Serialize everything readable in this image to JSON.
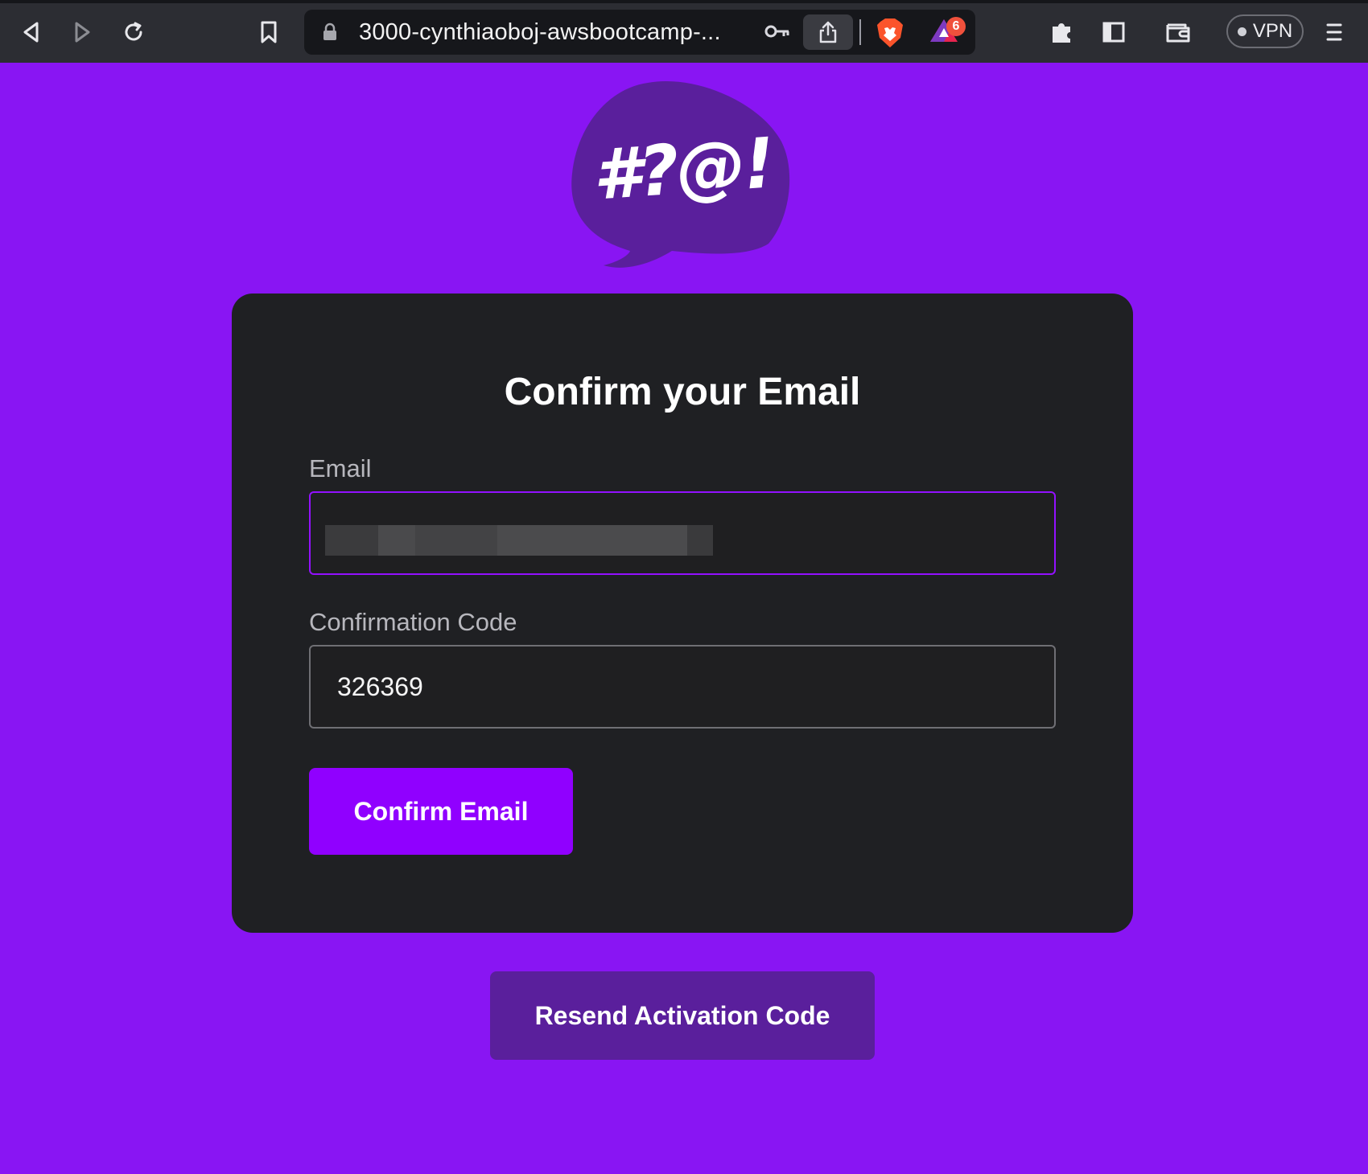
{
  "browser": {
    "url": "3000-cynthiaoboj-awsbootcamp-...",
    "rewards_badge": "6",
    "vpn_label": "VPN",
    "icons": [
      "back-icon",
      "forward-icon",
      "reload-icon",
      "bookmark-icon",
      "lock-icon",
      "key-icon",
      "share-icon",
      "brave-shields-icon",
      "brave-rewards-icon",
      "extensions-icon",
      "sidebar-icon",
      "wallet-icon",
      "menu-icon"
    ]
  },
  "logo": {
    "text": "#?@!"
  },
  "form": {
    "title": "Confirm your Email",
    "email_label": "Email",
    "email_value": "",
    "code_label": "Confirmation Code",
    "code_value": "326369",
    "submit_label": "Confirm Email"
  },
  "resend": {
    "label": "Resend Activation Code"
  },
  "colors": {
    "page_background": "#8915f3",
    "card_background": "#1f2023",
    "primary_button": "#9000ff",
    "secondary_button": "#5a1f9c",
    "focus_border": "#9311ff",
    "toolbar": "#2c2d33"
  }
}
